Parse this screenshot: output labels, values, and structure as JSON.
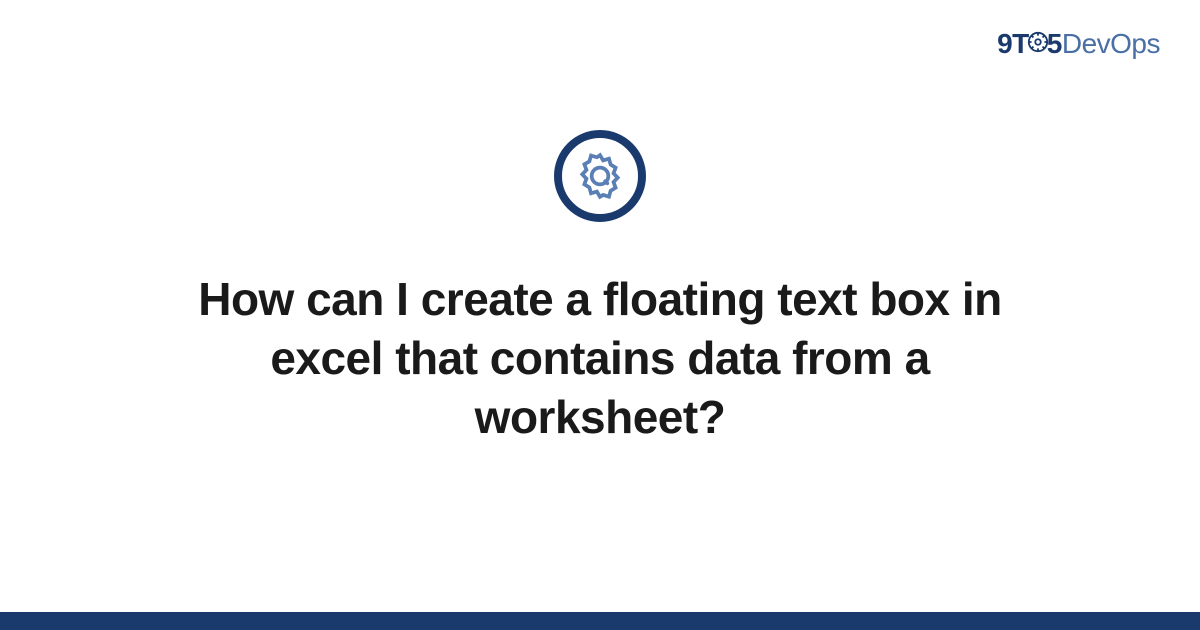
{
  "logo": {
    "part1": "9T",
    "part2": "5",
    "part3": "DevOps"
  },
  "question": {
    "title": "How can I create a floating text box in excel that contains data from a worksheet?"
  },
  "colors": {
    "primary": "#1a3a6e",
    "secondary": "#4a6fa5"
  }
}
